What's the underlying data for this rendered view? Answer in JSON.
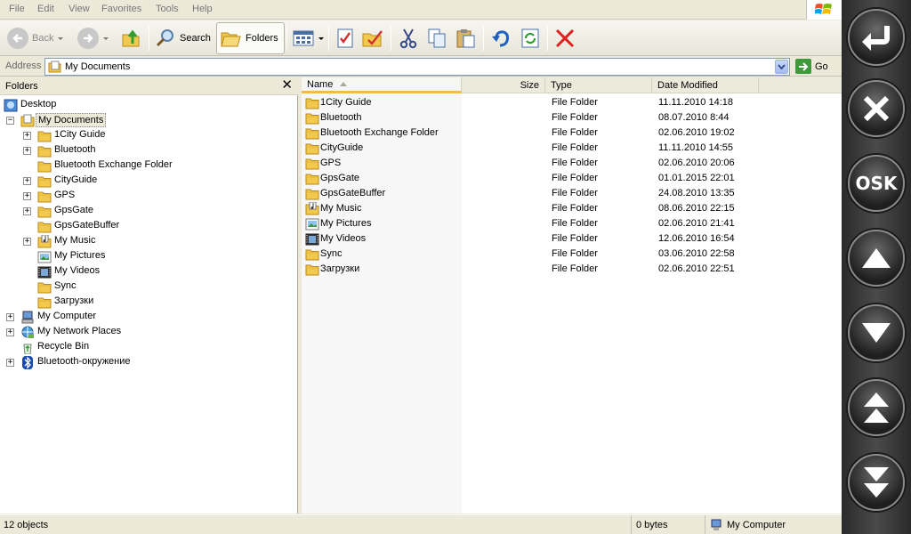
{
  "menu": [
    "File",
    "Edit",
    "View",
    "Favorites",
    "Tools",
    "Help"
  ],
  "toolbar": {
    "back_label": "Back",
    "search_label": "Search",
    "folders_label": "Folders"
  },
  "address": {
    "label": "Address",
    "value": "My Documents",
    "go_label": "Go"
  },
  "folders_pane": {
    "title": "Folders",
    "close_glyph": "✕",
    "tree": [
      {
        "label": "Desktop",
        "icon": "desktop-icon"
      },
      {
        "label": "My Documents",
        "icon": "my-documents-icon",
        "toggle": "−"
      },
      {
        "label": "1City Guide",
        "icon": "folder-icon",
        "toggle": "+"
      },
      {
        "label": "Bluetooth",
        "icon": "folder-icon",
        "toggle": "+"
      },
      {
        "label": "Bluetooth Exchange Folder",
        "icon": "folder-icon"
      },
      {
        "label": "CityGuide",
        "icon": "folder-icon",
        "toggle": "+"
      },
      {
        "label": "GPS",
        "icon": "folder-icon",
        "toggle": "+"
      },
      {
        "label": "GpsGate",
        "icon": "folder-icon",
        "toggle": "+"
      },
      {
        "label": "GpsGateBuffer",
        "icon": "folder-icon"
      },
      {
        "label": "My Music",
        "icon": "my-music-icon",
        "toggle": "+"
      },
      {
        "label": "My Pictures",
        "icon": "my-pictures-icon"
      },
      {
        "label": "My Videos",
        "icon": "my-videos-icon"
      },
      {
        "label": "Sync",
        "icon": "folder-icon"
      },
      {
        "label": "Загрузки",
        "icon": "folder-icon"
      },
      {
        "label": "My Computer",
        "icon": "computer-icon",
        "toggle": "+"
      },
      {
        "label": "My Network Places",
        "icon": "network-icon",
        "toggle": "+"
      },
      {
        "label": "Recycle Bin",
        "icon": "recycle-bin-icon"
      },
      {
        "label": "Bluetooth-окружение",
        "icon": "bluetooth-icon",
        "toggle": "+"
      }
    ]
  },
  "file_list": {
    "columns": [
      "Name",
      "Size",
      "Type",
      "Date Modified"
    ],
    "rows": [
      {
        "name": "1City Guide",
        "type": "File Folder",
        "date": "11.11.2010 14:18",
        "icon": "folder-icon"
      },
      {
        "name": "Bluetooth",
        "type": "File Folder",
        "date": "08.07.2010 8:44",
        "icon": "folder-icon"
      },
      {
        "name": "Bluetooth Exchange Folder",
        "type": "File Folder",
        "date": "02.06.2010 19:02",
        "icon": "folder-icon"
      },
      {
        "name": "CityGuide",
        "type": "File Folder",
        "date": "11.11.2010 14:55",
        "icon": "folder-icon"
      },
      {
        "name": "GPS",
        "type": "File Folder",
        "date": "02.06.2010 20:06",
        "icon": "folder-icon"
      },
      {
        "name": "GpsGate",
        "type": "File Folder",
        "date": "01.01.2015 22:01",
        "icon": "folder-icon"
      },
      {
        "name": "GpsGateBuffer",
        "type": "File Folder",
        "date": "24.08.2010 13:35",
        "icon": "folder-icon"
      },
      {
        "name": "My Music",
        "type": "File Folder",
        "date": "08.06.2010 22:15",
        "icon": "my-music-icon"
      },
      {
        "name": "My Pictures",
        "type": "File Folder",
        "date": "02.06.2010 21:41",
        "icon": "my-pictures-icon"
      },
      {
        "name": "My Videos",
        "type": "File Folder",
        "date": "12.06.2010 16:54",
        "icon": "my-videos-icon"
      },
      {
        "name": "Sync",
        "type": "File Folder",
        "date": "03.06.2010 22:58",
        "icon": "folder-icon"
      },
      {
        "name": "Загрузки",
        "type": "File Folder",
        "date": "02.06.2010 22:51",
        "icon": "folder-icon"
      }
    ]
  },
  "status": {
    "objects": "12 objects",
    "size": "0 bytes",
    "zone": "My Computer"
  },
  "side_panel": {
    "osk_label": "OSK",
    "buttons": [
      "enter-icon",
      "close-icon",
      "osk-button",
      "arrow-up-icon",
      "arrow-down-icon",
      "page-up-icon",
      "page-down-icon"
    ]
  },
  "colors": {
    "folder": "#f2c94c",
    "selection_frame": "#ece9d8",
    "sort_highlight": "#f9b84a",
    "delete_red": "#e02020"
  }
}
